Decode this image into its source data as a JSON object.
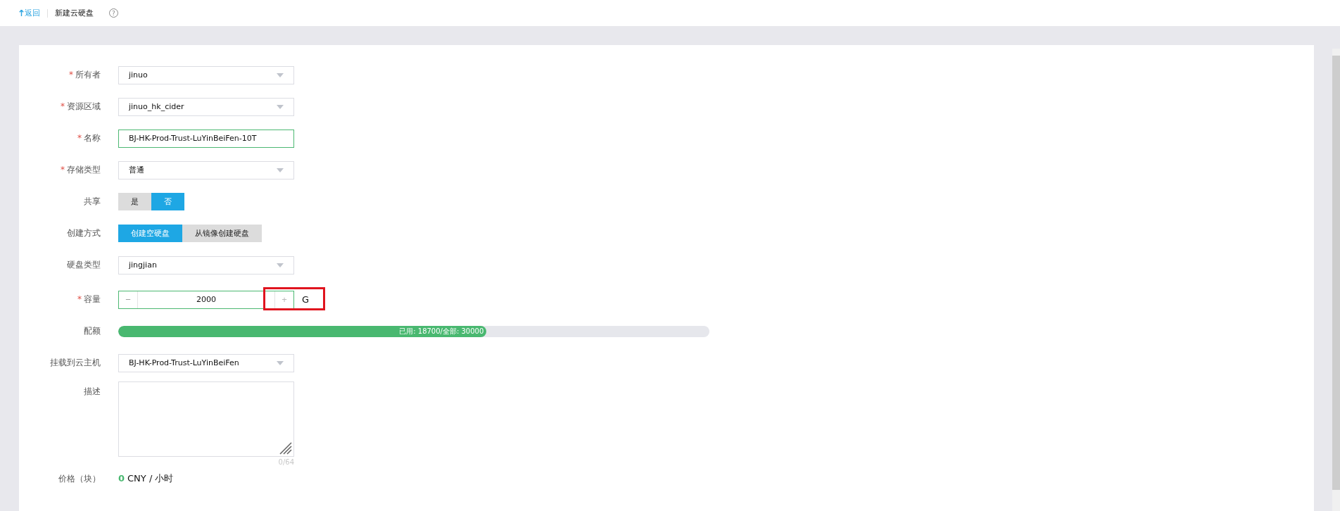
{
  "header": {
    "back": "返回",
    "title": "新建云硬盘",
    "help": "?"
  },
  "fields": [
    {
      "kind": "select",
      "label": "所有者",
      "mark": "*",
      "value": "jinuo"
    },
    {
      "kind": "select",
      "label": "资源区域",
      "mark": "*",
      "value": "jinuo_hk_cider"
    },
    {
      "kind": "input",
      "label": "名称",
      "mark": "*",
      "value": "BJ-HK-Prod-Trust-LuYinBeiFen-10T"
    },
    {
      "kind": "select",
      "label": "存储类型",
      "mark": "*",
      "value": "普通"
    },
    {
      "kind": "toggle",
      "label": "共享",
      "options": [
        {
          "label": "是",
          "selected": false
        },
        {
          "label": "否",
          "selected": true
        }
      ]
    },
    {
      "kind": "toggle",
      "label": "创建方式",
      "options": [
        {
          "label": "创建空硬盘",
          "selected": true
        },
        {
          "label": "从镜像创建硬盘",
          "selected": false
        }
      ]
    },
    {
      "kind": "select",
      "label": "硬盘类型",
      "value": "jingjian"
    },
    {
      "kind": "stepper",
      "label": "容量",
      "mark": "*",
      "minus": "−",
      "value": "2000",
      "plus": "+",
      "unit": "G"
    },
    {
      "kind": "quota",
      "label": "配额",
      "level": 0.623,
      "text": "已用: 18700/全部: 30000"
    },
    {
      "kind": "select",
      "label": "挂载到云主机",
      "value": "BJ-HK-Prod-Trust-LuYinBeiFen"
    },
    {
      "kind": "textarea",
      "label": "描述",
      "counter": "0/64"
    },
    {
      "kind": "price",
      "label": "价格（块）",
      "value": "0",
      "unit": "CNY / 小时"
    }
  ]
}
